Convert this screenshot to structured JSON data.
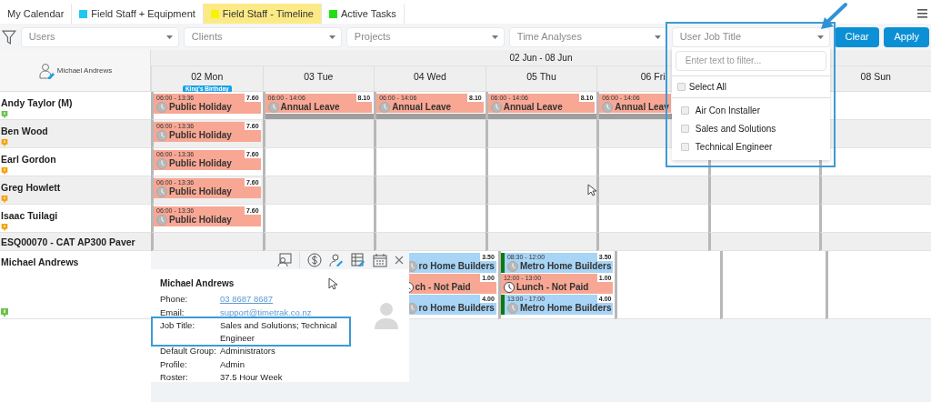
{
  "tabs": [
    {
      "label": "My Calendar",
      "selected": false
    },
    {
      "label": "Field Staff + Equipment",
      "color": "#1ec8f0",
      "selected": false
    },
    {
      "label": "Field Staff - Timeline",
      "color": "#f5f500",
      "selected": true
    },
    {
      "label": "Active Tasks",
      "color": "#22dd11",
      "selected": false
    }
  ],
  "filters": [
    {
      "placeholder": "Users"
    },
    {
      "placeholder": "Clients"
    },
    {
      "placeholder": "Projects"
    },
    {
      "placeholder": "Time Analyses"
    },
    {
      "placeholder": "User Job Title",
      "highlighted": true,
      "callout_arrow": true,
      "dropdown": {
        "placeholder": "Enter text to filter...",
        "select_all": {
          "label": "Select All",
          "checked": false
        },
        "options": [
          {
            "label": "Air Con Installer",
            "checked": false
          },
          {
            "label": "Sales and Solutions",
            "checked": false
          },
          {
            "label": "Technical Engineer",
            "checked": false
          }
        ]
      }
    }
  ],
  "buttons": [
    "Clear",
    "Apply"
  ],
  "calendar": {
    "current_user": "Michael Andrews",
    "week": "02 Jun - 08 Jun",
    "days": [
      {
        "label": "02 Mon",
        "holiday": "King's Birthday"
      },
      {
        "label": "03 Tue"
      },
      {
        "label": "04 Wed"
      },
      {
        "label": "05 Thu"
      },
      {
        "label": "06 Fri"
      }
    ],
    "last_day": {
      "label": "08 Sun"
    },
    "rows": [
      {
        "name": "Andy Taylor (M)",
        "color": "#6cc04a",
        "cells": [
          {
            "events": [
              {
                "kind": "leave",
                "time": "06:00 - 13:36",
                "hours": "7.60",
                "title": "Public Holiday"
              }
            ]
          },
          {
            "bar": true,
            "events": [
              {
                "kind": "leave",
                "time": "06:00 - 14:06",
                "hours": "8.10",
                "title": "Annual Leave"
              }
            ]
          },
          {
            "bar": true,
            "events": [
              {
                "kind": "leave",
                "time": "06:00 - 14:06",
                "hours": "8.10",
                "title": "Annual Leave"
              }
            ]
          },
          {
            "bar": true,
            "events": [
              {
                "kind": "leave",
                "time": "06:00 - 14:06",
                "hours": "8.10",
                "title": "Annual Leave"
              }
            ]
          },
          {
            "bar": true,
            "events": [
              {
                "kind": "leave",
                "time": "06:00 - 14:06",
                "title": "Annual Leav"
              }
            ]
          },
          {},
          {}
        ]
      },
      {
        "name": "Ben Wood",
        "color": "#f5a000",
        "cells": [
          {
            "events": [
              {
                "kind": "leave",
                "time": "06:00 - 13:36",
                "hours": "7.60",
                "title": "Public Holiday"
              }
            ]
          },
          {},
          {},
          {},
          {},
          {},
          {}
        ]
      },
      {
        "name": "Earl Gordon",
        "color": "#f5a000",
        "cells": [
          {
            "events": [
              {
                "kind": "leave",
                "time": "06:00 - 13:36",
                "hours": "7.60",
                "title": "Public Holiday"
              }
            ]
          },
          {},
          {},
          {},
          {},
          {},
          {}
        ]
      },
      {
        "name": "Greg Howlett",
        "color": "#f5a000",
        "cells": [
          {
            "events": [
              {
                "kind": "leave",
                "time": "06:00 - 13:36",
                "hours": "7.60",
                "title": "Public Holiday"
              }
            ]
          },
          {},
          {},
          {},
          {},
          {},
          {}
        ]
      },
      {
        "name": "Isaac Tuilagi",
        "color": "#f5a000",
        "cells": [
          {
            "events": [
              {
                "kind": "leave",
                "time": "06:00 - 13:36",
                "hours": "7.60",
                "title": "Public Holiday"
              }
            ]
          },
          {},
          {},
          {},
          {},
          {},
          {}
        ]
      },
      {
        "name": "ESQ00070 - CAT AP300 Paver",
        "cells": [
          {},
          {},
          {},
          {},
          {},
          {},
          {}
        ]
      },
      {
        "name": "Michael Andrews",
        "color": "#6cc04a",
        "cells": [
          {},
          {},
          {
            "events": [
              {
                "kind": "job",
                "hours": "3.50",
                "title": "ro Home Builders"
              },
              {
                "kind": "break",
                "hours": "1.00",
                "title": "ch - Not Paid"
              },
              {
                "kind": "job",
                "hours": "4.00",
                "title": "ro Home Builders"
              }
            ]
          },
          {
            "events": [
              {
                "kind": "job",
                "time": "08:30 - 12:00",
                "hours": "3.50",
                "title": "Metro Home Builders"
              },
              {
                "kind": "break",
                "time": "12:00 - 13:00",
                "hours": "1.00",
                "title": "Lunch - Not Paid"
              },
              {
                "kind": "job",
                "time": "13:00 - 17:00",
                "hours": "4.00",
                "title": "Metro Home Builders"
              }
            ]
          },
          {},
          {},
          {}
        ]
      }
    ]
  },
  "user_popup": {
    "name": "Michael Andrews",
    "fields": [
      {
        "label": "Phone:",
        "value": "03 8687 8687",
        "kind": "link"
      },
      {
        "label": "Email:",
        "value": "support@timetrak.co.nz",
        "kind": "link"
      },
      {
        "label": "Job Title:",
        "value": "Sales and Solutions; Technical Engineer",
        "kind": "text",
        "highlighted": true
      },
      {
        "label": "Default Group:",
        "value": "Administrators",
        "kind": "text"
      },
      {
        "label": "Profile:",
        "value": "Admin",
        "kind": "text"
      },
      {
        "label": "Roster:",
        "value": "37.5 Hour Week",
        "kind": "text"
      }
    ]
  }
}
